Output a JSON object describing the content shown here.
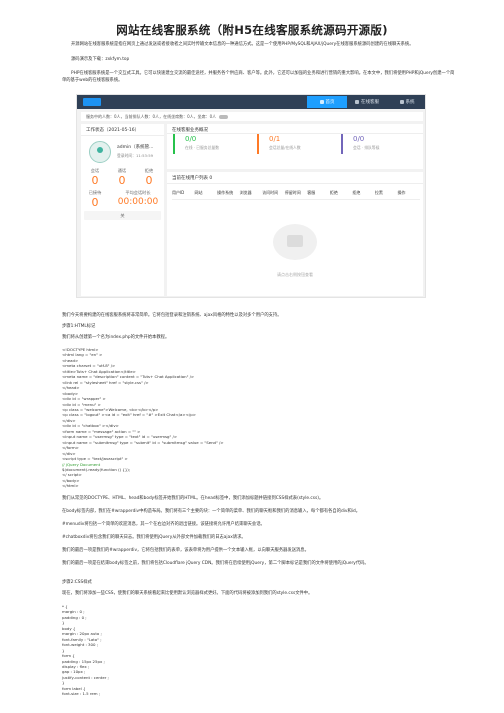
{
  "title": "网站在线客服系统（附H5在线客服系统源码开源版)",
  "intro": [
    "开源网站在线客服系统是指在网页上通过发送或者接收者之间实时传输文本信息的一种通信方式。这是一个使用PHP/MySQL和AJAX/jQuery在线客服系统源码创建的在线聊天系统。",
    "源码演示及下载：zxkfym.top",
    "PHP在线客服系统是一个交互式工具。它可以快速建立交流的最佳途径，并服务各个供应商、客户等。此外，它还可以加强的业务和进行营销的重大影响。在本文中，我们将使用PHP和jQuery创建一个简单的基于web的在线客服系统。"
  ],
  "ui": {
    "tabs": [
      "首页",
      "在线客服",
      "系统",
      "账号"
    ],
    "infobar": "服务中的人数：0人，当前排队人数：0人，在线坐席数：0人，坐席：0人",
    "ws_title": "工作状态（2021-05-16）",
    "agent_name": "admin（系统管...",
    "login_time": "登录时间：11:53:59",
    "stat_labels_1": [
      "会话",
      "通话",
      "拒绝"
    ],
    "stat_values_1": [
      "0",
      "0",
      "0"
    ],
    "stat_labels_2": [
      "已接待",
      "平均会话时长"
    ],
    "stat_values_2": [
      "0",
      "00:00:00"
    ],
    "button": "关",
    "overview_title": "在线客服业务概况",
    "overview": [
      {
        "num": "0/0",
        "label": "在线 · 已服务总量数",
        "color": "#27c24c"
      },
      {
        "num": "0/1",
        "label": "会话总量/在线人数",
        "color": "#ff7a26"
      },
      {
        "num": "0/0",
        "label": "会话 · 排队等候",
        "color": "#7266ba"
      }
    ],
    "queue_title": "当前在线用户列表 0",
    "columns": [
      "用户ID",
      "网站",
      "操作系统",
      "浏览器",
      "访问时间",
      "停留时间",
      "客服",
      "拒绝",
      "拒绝",
      "拉黑",
      "操作"
    ],
    "empty_text": "请点击右侧按钮查看"
  },
  "body_paras": [
    "我们今天将要构建的在线客服系统将非常简单。它将包括登录和注销系统、ajax风格的特性以及对多个用户的支持。",
    "步骤1:HTML标记",
    "我们将从创建第一个名为index.php的文件开始本教程。"
  ],
  "code1": [
    "<!DOCTYPE html>",
    "<html lang = \"en\" >",
    "<head>",
    "<meta charset = \"utf-8\" />",
    "<title>Tuts+ Chat Application</title>",
    "<meta name = \"description\" content = \"Tuts+ Chat Application\" />",
    "<link rel = \"stylesheet\" href = \"style.css\" />",
    "</head>",
    "<body>",
    "<div id = \"wrapper\" >",
    "<div id = \"menu\" >",
    "<p class = \"welcome\">Welcome, <b></b></p>",
    "<p class = \"logout\" ><a id = \"exit\" href = \"#\" >Exit Chat</a></p>",
    "</div>",
    "<div id = \"chatbox\" ></div>",
    "<form name = \"message\" action = \"\" >",
    "<input name = \"usermsg\" type = \"text\" id = \"usermsg\" />",
    "<input name = \"submitmsg\" type = \"submit\" id = \"submitmsg\" value = \"Send\" />",
    "</form>",
    "</div>",
    "<script type = \"text/javascript\" >",
    "// jQuery Document",
    "$(document).ready(function () {});",
    "</ script>",
    "</body>",
    "</html>"
  ],
  "explain": [
    "我们从常见的DOCTYPE、HTML、head和body标签开始我们的HTML。在head标签中，我们添加标题并链接到CSS样式表(style.css)。",
    "在body标签内部，我们在#wrapperdiv中构造布局。我们将有三个主要的块：一个简单的菜单、我们的聊天框和我们的消息输入，每个都有各自的div和id。",
    "#menudiv将包括一个简单的欢迎消息，其一个在右边对齐的退出链接。该链接将允许用户结束聊天会话。",
    "#chatboxdiv将包含我们的聊天日志。我们将使用jQuery从外部文件加载我们的日志ajax请求。",
    "我们的最后一项是我们的#wrapperdiv，它将包括我们的表单，该表单将为用户提供一个文本输入框，以向聊天服务器发送消息。",
    "我们的最后一项是在结束body标签之前，我们将包括Cloudflare jQuery CDN。我们将在后续使用jQuery，第二个脚本标记是我们的文件将使用的jQuery代码。"
  ],
  "step2": "步骤2:CSS样式",
  "step2_text": "现在，我们将添加一些CSS，使我们的聊天系统看起来比使用默认浏览器样式更好。下面的代码将被添加到我们的style.css文件中。",
  "code2": [
    "* {",
    "margin : 0 ;",
    "padding : 0 ;",
    "}",
    "body {",
    "margin : 20px auto ;",
    "font-family : \"Lato\" ;",
    "font-weight : 300 ;",
    "}",
    "form {",
    "padding : 15px 25px ;",
    "display : flex ;",
    "gap : 10px ;",
    "justify-content : center ;",
    "}",
    "form label {",
    "font-size : 1.5 rem ;"
  ]
}
